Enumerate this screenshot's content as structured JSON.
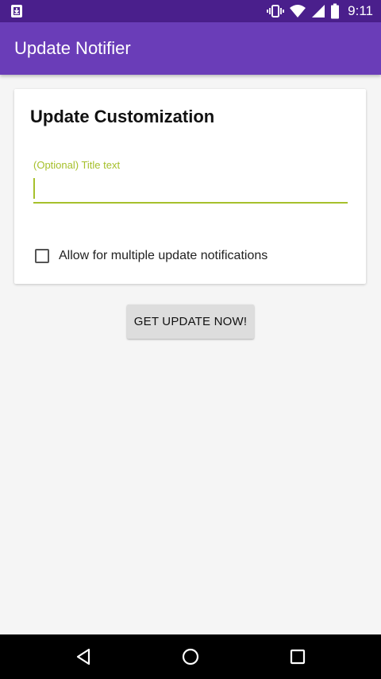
{
  "status_bar": {
    "time": "9:11",
    "icons": [
      "download-notification-icon",
      "vibrate-icon",
      "wifi-icon",
      "signal-icon",
      "battery-icon"
    ]
  },
  "app_bar": {
    "title": "Update Notifier"
  },
  "card": {
    "title": "Update Customization",
    "title_field": {
      "label": "(Optional) Title text",
      "value": ""
    },
    "checkbox": {
      "label": "Allow for multiple update notifications",
      "checked": false
    }
  },
  "button": {
    "label": "GET UPDATE NOW!"
  },
  "nav_bar": {
    "icons": [
      "back-icon",
      "home-icon",
      "recents-icon"
    ]
  },
  "colors": {
    "status_bar": "#4a1f8c",
    "app_bar": "#6a3db8",
    "accent": "#a6c02b",
    "background": "#f5f5f5"
  }
}
